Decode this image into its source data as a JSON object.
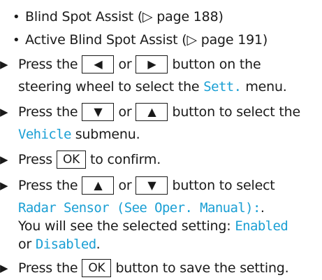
{
  "bullets": [
    {
      "text": "Blind Spot Assist (▷ page 188)"
    },
    {
      "text": "Active Blind Spot Assist (▷ page 191)"
    }
  ],
  "step_marker": "▶",
  "bullet_marker": "•",
  "keys": {
    "left": "◀",
    "right": "▶",
    "down": "▼",
    "up": "▲",
    "ok": "OK"
  },
  "steps": [
    {
      "l1_a": "Press the",
      "l1_or": "or",
      "l1_b": "button on the",
      "l2_a": "steering wheel to select the",
      "l2_menu": "Sett.",
      "l2_b": "menu."
    },
    {
      "l1_a": "Press the",
      "l1_or": "or",
      "l1_b": "button to select the",
      "l2_menu": "Vehicle",
      "l2_b": "submenu."
    },
    {
      "l1_a": "Press",
      "l1_b": "to confirm."
    },
    {
      "l1_a": "Press the",
      "l1_or": "or",
      "l1_b": "button to select",
      "l2_menu": "Radar Sensor (See Oper. Manual):",
      "l2_b": ".",
      "l3_a": "You will see the selected setting:",
      "l3_enabled": "Enabled",
      "l4_or": "or",
      "l4_disabled": "Disabled",
      "l4_b": "."
    },
    {
      "l1_a": "Press the",
      "l1_b": "button to save the setting."
    }
  ],
  "colors": {
    "menu_text": "#1a9fd4",
    "body_text": "#1a1a1a"
  }
}
